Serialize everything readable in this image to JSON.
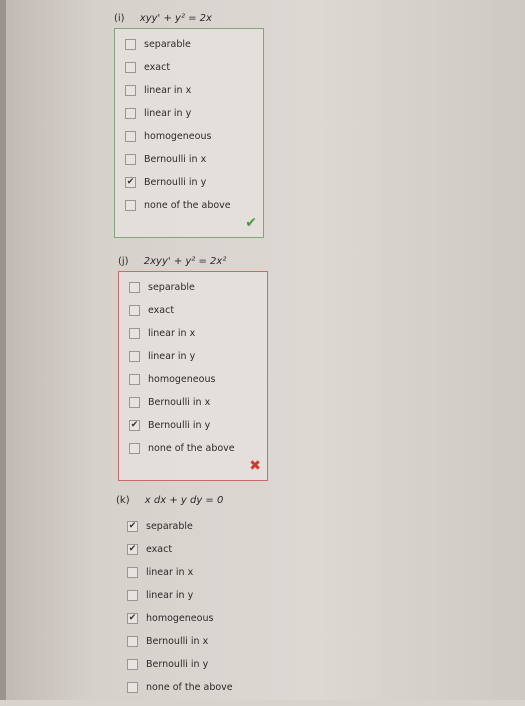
{
  "questions": [
    {
      "number": "(i)",
      "equation": "xyy' + y² = 2x",
      "options": [
        {
          "label": "separable",
          "checked": false
        },
        {
          "label": "exact",
          "checked": false
        },
        {
          "label": "linear in x",
          "checked": false
        },
        {
          "label": "linear in y",
          "checked": false
        },
        {
          "label": "homogeneous",
          "checked": false
        },
        {
          "label": "Bernoulli in x",
          "checked": false
        },
        {
          "label": "Bernoulli in y",
          "checked": true
        },
        {
          "label": "none of the above",
          "checked": false
        }
      ],
      "result_mark": "✔",
      "result": "correct"
    },
    {
      "number": "(j)",
      "equation": "2xyy' + y² = 2x²",
      "options": [
        {
          "label": "separable",
          "checked": false
        },
        {
          "label": "exact",
          "checked": false
        },
        {
          "label": "linear in x",
          "checked": false
        },
        {
          "label": "linear in y",
          "checked": false
        },
        {
          "label": "homogeneous",
          "checked": false
        },
        {
          "label": "Bernoulli in x",
          "checked": false
        },
        {
          "label": "Bernoulli in y",
          "checked": true
        },
        {
          "label": "none of the above",
          "checked": false
        }
      ],
      "result_mark": "✖",
      "result": "incorrect"
    },
    {
      "number": "(k)",
      "equation": "x dx + y dy = 0",
      "options": [
        {
          "label": "separable",
          "checked": true
        },
        {
          "label": "exact",
          "checked": true
        },
        {
          "label": "linear in x",
          "checked": false
        },
        {
          "label": "linear in y",
          "checked": false
        },
        {
          "label": "homogeneous",
          "checked": true
        },
        {
          "label": "Bernoulli in x",
          "checked": false
        },
        {
          "label": "Bernoulli in y",
          "checked": false
        },
        {
          "label": "none of the above",
          "checked": false
        }
      ],
      "result_mark": "",
      "result": ""
    }
  ],
  "colors": {
    "correct": "#4b9a3b",
    "incorrect": "#d03a2e",
    "box_border_correct": "#7fa67d",
    "box_border_incorrect": "#c96b6b"
  },
  "icons": {
    "checked": "check-mark-icon",
    "correct": "green-check-icon",
    "incorrect": "red-x-icon"
  }
}
